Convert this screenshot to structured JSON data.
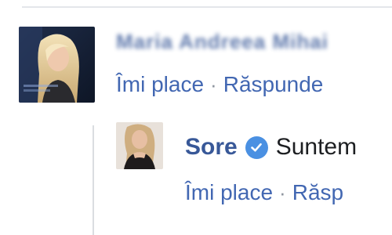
{
  "comment": {
    "author_blurred": "Maria Andreea Mihai",
    "actions": {
      "like": "Îmi place",
      "separator": "·",
      "reply": "Răspunde"
    }
  },
  "reply": {
    "author": "Sore",
    "verified_icon": "verified-check-icon",
    "text": "Suntem",
    "actions": {
      "like": "Îmi place",
      "separator": "·",
      "reply": "Răsp"
    }
  },
  "colors": {
    "link_blue": "#4267b2",
    "name_blue": "#385898",
    "badge_blue": "#4a90e2",
    "text": "#1c1e21"
  }
}
